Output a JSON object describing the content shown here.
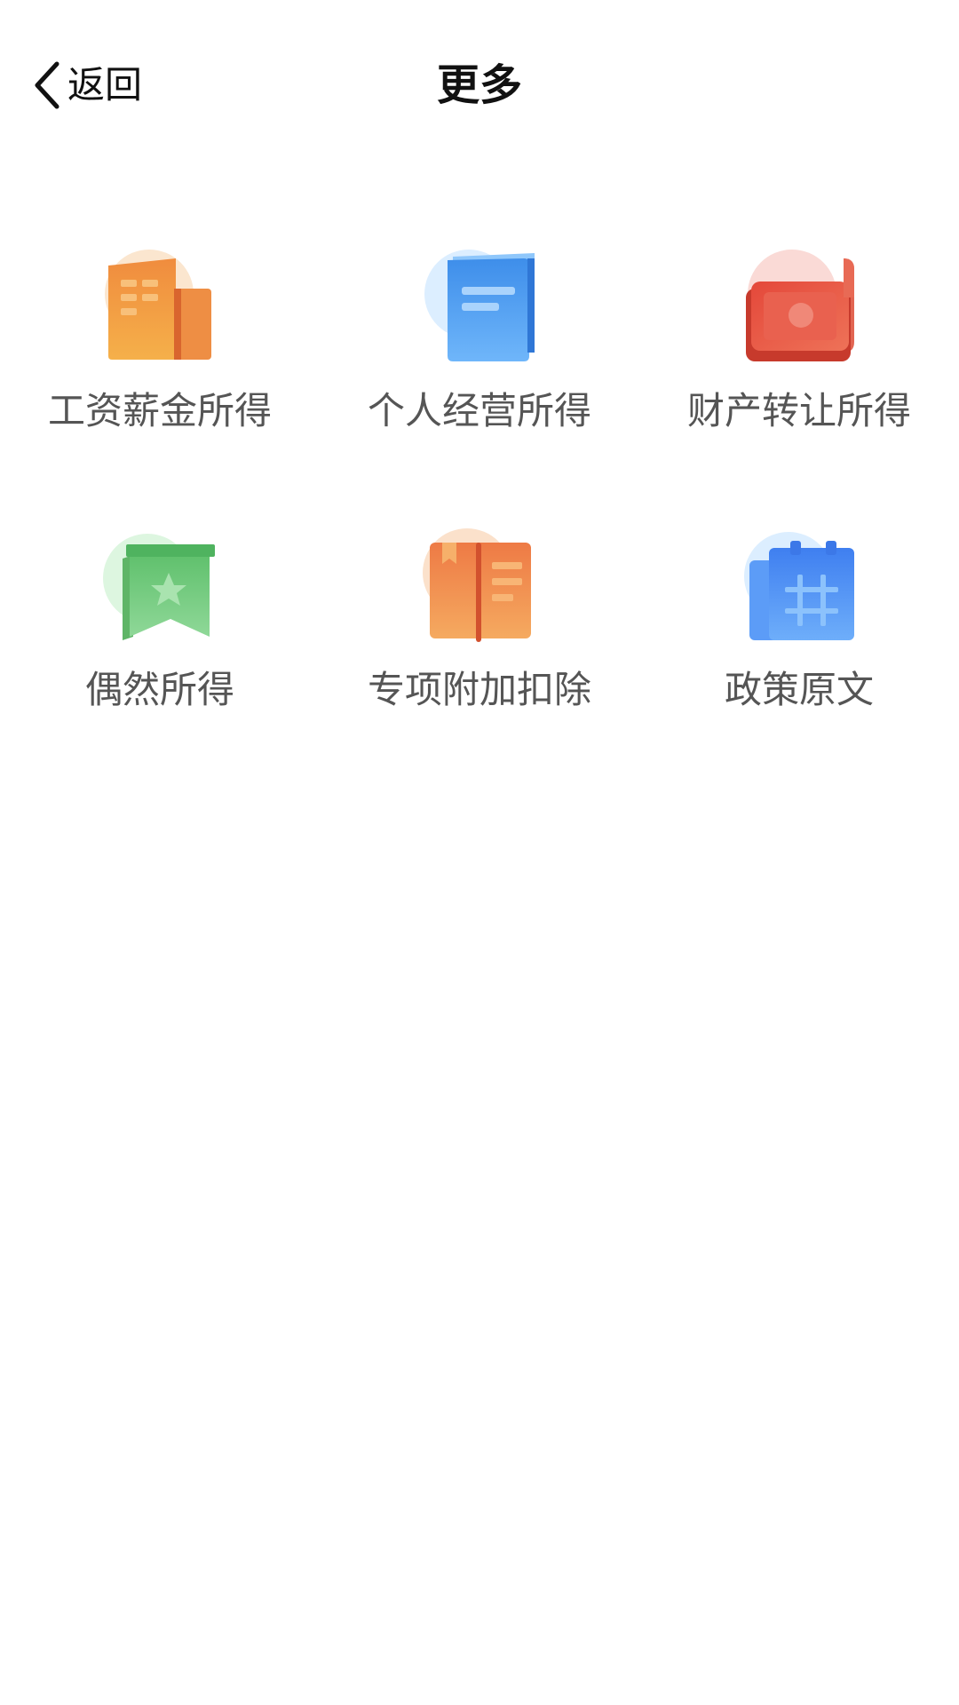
{
  "header": {
    "back_label": "返回",
    "title": "更多"
  },
  "items": [
    {
      "label": "工资薪金所得",
      "icon": "building-icon",
      "color": "#F0A040"
    },
    {
      "label": "个人经营所得",
      "icon": "booklet-icon",
      "color": "#4FA3F7"
    },
    {
      "label": "财产转让所得",
      "icon": "money-icon",
      "color": "#E5533D"
    },
    {
      "label": "偶然所得",
      "icon": "flag-star-icon",
      "color": "#6CCB7E"
    },
    {
      "label": "专项附加扣除",
      "icon": "open-book-icon",
      "color": "#F08A45"
    },
    {
      "label": "政策原文",
      "icon": "calendar-icon",
      "color": "#4D8EF5"
    }
  ]
}
